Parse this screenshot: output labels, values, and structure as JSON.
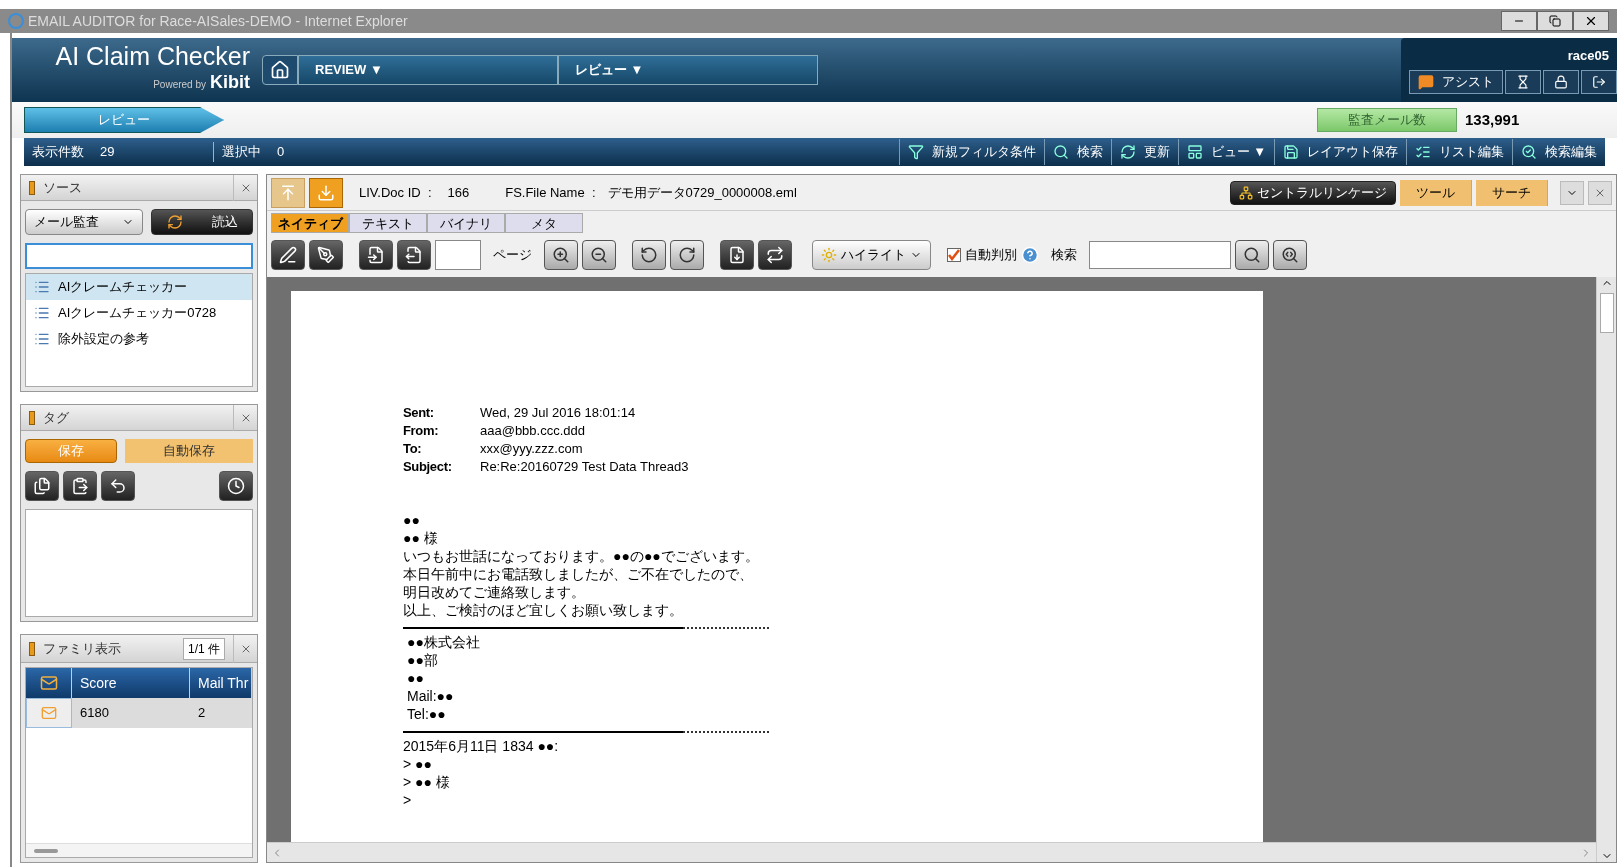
{
  "window": {
    "title": "EMAIL AUDITOR for Race-AISales-DEMO - Internet Explorer"
  },
  "header": {
    "app_name": "AI Claim Checker",
    "powered_by": "Powered by",
    "brand": "Kibit",
    "breadcrumbs": [
      "REVIEW ▼",
      "レビュー ▼"
    ],
    "user": "race05",
    "assist_button": "アシスト"
  },
  "stage": {
    "label": "レビュー",
    "audit_count_label": "監査メール数",
    "audit_count": "133,991"
  },
  "toolbar": {
    "shown_label": "表示件数",
    "shown_count": "29",
    "selected_label": "選択中",
    "selected_count": "0",
    "buttons": [
      "新規フィルタ条件",
      "検索",
      "更新",
      "ビュー ▼",
      "レイアウト保存",
      "リスト編集",
      "検索編集"
    ]
  },
  "source_panel": {
    "title": "ソース",
    "dropdown": "メール監査",
    "load_button": "読込",
    "items": [
      {
        "label": "AIクレームチェッカー",
        "selected": true
      },
      {
        "label": "AIクレームチェッカー0728",
        "selected": false
      },
      {
        "label": "除外設定の参考",
        "selected": false
      }
    ]
  },
  "tag_panel": {
    "title": "タグ",
    "save_button": "保存",
    "autosave_button": "自動保存"
  },
  "family_panel": {
    "title": "ファミリ表示",
    "count": "1/1 件",
    "columns": [
      "Score",
      "Mail Thr"
    ],
    "rows": [
      {
        "cells": [
          "6180",
          "2"
        ],
        "selected": true
      }
    ]
  },
  "viewer": {
    "doc_id_label": "LIV.Doc ID  :",
    "doc_id": "166",
    "file_label": "FS.File Name  :",
    "file_name": "デモ用データ0729_0000008.eml",
    "linkage_button": "セントラルリンケージ",
    "side_buttons": [
      "ツール",
      "サーチ"
    ],
    "tabs": [
      {
        "label": "ネイティブ",
        "selected": true
      },
      {
        "label": "テキスト",
        "selected": false
      },
      {
        "label": "バイナリ",
        "selected": false
      },
      {
        "label": "メタ",
        "selected": false
      }
    ],
    "page_label": "ページ",
    "highlight_button": "ハイライト",
    "auto_detect": {
      "label": "自動判別",
      "checked": true
    },
    "search_label": "検索"
  },
  "document": {
    "headers": [
      {
        "label": "Sent:",
        "value": "Wed, 29 Jul 2016 18:01:14"
      },
      {
        "label": "From:",
        "value": "aaa@bbb.ccc.ddd"
      },
      {
        "label": "To:",
        "value": "xxx@yyy.zzz.com"
      },
      {
        "label": "Subject:",
        "value": "Re:Re:20160729 Test Data Thread3"
      }
    ],
    "body": [
      "●●",
      "●● 様",
      "いつもお世話になっております。●●の●●でございます。",
      "本日午前中にお電話致しましたが、ご不在でしたので、",
      "明日改めてご連絡致します。",
      "以上、ご検討のほど宜しくお願い致します。"
    ],
    "signature": [
      "●●株式会社",
      "●●部",
      "●●",
      "Mail:●●",
      "Tel:●●"
    ],
    "quote": [
      "2015年6月11日 1834 ●●:",
      "> ●●",
      "> ●● 様",
      ">"
    ]
  }
}
